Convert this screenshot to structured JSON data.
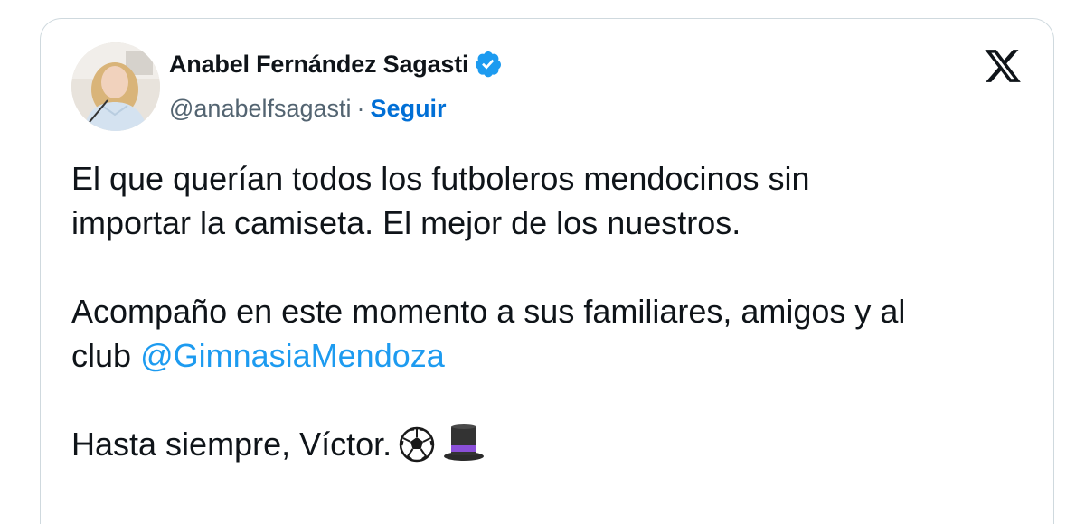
{
  "author": {
    "name": "Anabel Fernández Sagasti",
    "handle": "@anabelfsagasti",
    "separator": "·",
    "follow_label": "Seguir",
    "verified_icon": "verified-badge-icon",
    "verified_color": "#1d9bf0"
  },
  "platform_logo": "x-logo-icon",
  "tweet": {
    "line1": "El que querían todos los futboleros mendocinos sin",
    "line2": "importar la camiseta. El mejor de los nuestros.",
    "line3": "Acompaño en este momento a sus familiares, amigos y al",
    "line4_prefix": "club",
    "mention": "@GimnasiaMendoza",
    "line5": "Hasta siempre, Víctor.",
    "emojis": [
      "soccer-ball-icon",
      "top-hat-icon"
    ]
  },
  "colors": {
    "text": "#0f1419",
    "secondary": "#536471",
    "link": "#1d9bf0",
    "follow": "#006fd6",
    "border": "#cfd9de"
  }
}
